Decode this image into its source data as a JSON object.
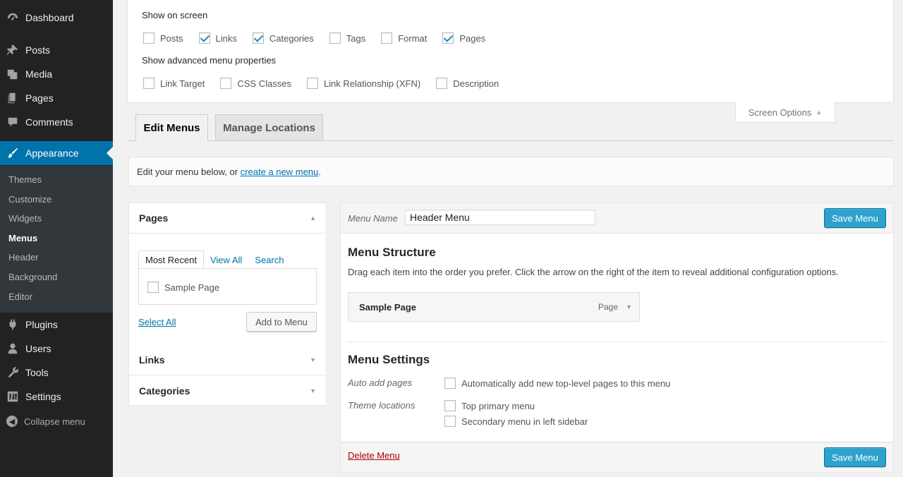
{
  "sidebar": {
    "items": [
      {
        "label": "Dashboard",
        "icon": "dashboard-icon"
      },
      {
        "label": "Posts",
        "icon": "pin-icon"
      },
      {
        "label": "Media",
        "icon": "media-icon"
      },
      {
        "label": "Pages",
        "icon": "page-icon"
      },
      {
        "label": "Comments",
        "icon": "comment-icon"
      },
      {
        "label": "Appearance",
        "icon": "paintbrush-icon"
      },
      {
        "label": "Plugins",
        "icon": "plugin-icon"
      },
      {
        "label": "Users",
        "icon": "user-icon"
      },
      {
        "label": "Tools",
        "icon": "wrench-icon"
      },
      {
        "label": "Settings",
        "icon": "settings-icon"
      }
    ],
    "submenu": [
      "Themes",
      "Customize",
      "Widgets",
      "Menus",
      "Header",
      "Background",
      "Editor"
    ],
    "collapse_label": "Collapse menu"
  },
  "screen_options": {
    "show_on_screen_heading": "Show on screen",
    "show_on_screen": [
      {
        "label": "Posts",
        "checked": false
      },
      {
        "label": "Links",
        "checked": true
      },
      {
        "label": "Categories",
        "checked": true
      },
      {
        "label": "Tags",
        "checked": false
      },
      {
        "label": "Format",
        "checked": false
      },
      {
        "label": "Pages",
        "checked": true
      }
    ],
    "advanced_heading": "Show advanced menu properties",
    "advanced": [
      {
        "label": "Link Target",
        "checked": false
      },
      {
        "label": "CSS Classes",
        "checked": false
      },
      {
        "label": "Link Relationship (XFN)",
        "checked": false
      },
      {
        "label": "Description",
        "checked": false
      }
    ],
    "toggle_label": "Screen Options"
  },
  "tabs": {
    "edit": "Edit Menus",
    "manage": "Manage Locations"
  },
  "notice": {
    "prefix": "Edit your menu below, or",
    "link": "create a new menu",
    "suffix": "."
  },
  "accordion": {
    "pages_title": "Pages",
    "inner_tabs": [
      "Most Recent",
      "View All",
      "Search"
    ],
    "page_item": "Sample Page",
    "select_all": "Select All",
    "add_to_menu": "Add to Menu",
    "links_title": "Links",
    "categories_title": "Categories"
  },
  "menu": {
    "name_label": "Menu Name",
    "name_value": "Header Menu",
    "save_label": "Save Menu",
    "structure_title": "Menu Structure",
    "structure_help": "Drag each item into the order you prefer. Click the arrow on the right of the item to reveal additional configuration options.",
    "item_title": "Sample Page",
    "item_type": "Page",
    "settings_title": "Menu Settings",
    "auto_add_label": "Auto add pages",
    "auto_add_option": "Automatically add new top-level pages to this menu",
    "locations_label": "Theme locations",
    "locations": [
      "Top primary menu",
      "Secondary menu in left sidebar"
    ],
    "delete_label": "Delete Menu"
  },
  "colors": {
    "sidebar_bg": "#222222",
    "active_blue": "#0073aa",
    "primary_button": "#2ea2cc",
    "delete_red": "#a00000"
  }
}
